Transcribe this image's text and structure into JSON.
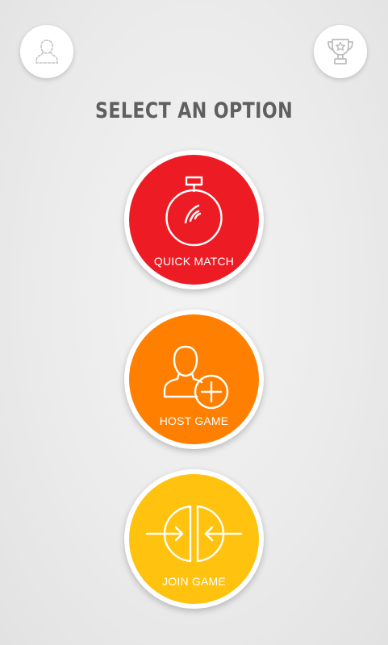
{
  "header": {
    "profile_icon": "user-outline-icon",
    "trophy_icon": "trophy-star-icon"
  },
  "title": "SELECT AN OPTION",
  "options": [
    {
      "label": "QUICK MATCH",
      "icon": "stopwatch-icon",
      "color": "#ed1c24"
    },
    {
      "label": "HOST GAME",
      "icon": "user-add-icon",
      "color": "#ff7f00"
    },
    {
      "label": "JOIN GAME",
      "icon": "join-arrows-icon",
      "color": "#ffc20e"
    }
  ],
  "colors": {
    "title": "#5f5f5f",
    "icon_gray": "#c8c8c8"
  }
}
